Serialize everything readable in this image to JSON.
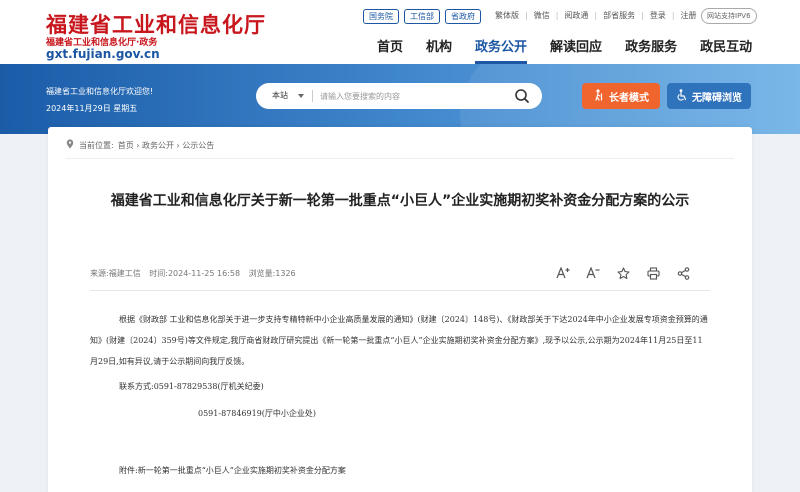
{
  "header": {
    "site_title": "福建省工业和信息化厅",
    "site_subtitle": "福建省工业和信息化厅·政务",
    "site_url": "gxt.fujian.gov.cn",
    "top_tags": [
      "国务院",
      "工信部",
      "省政府"
    ],
    "top_links": [
      "繁体版",
      "微信",
      "阅政通",
      "部省服务",
      "登录",
      "注册"
    ],
    "ipv6_badge": "网站支持IPV6",
    "nav": [
      "首页",
      "机构",
      "政务公开",
      "解读回应",
      "政务服务",
      "政民互动"
    ],
    "active_nav": "政务公开"
  },
  "banner": {
    "welcome": "福建省工业和信息化厅欢迎您!",
    "date": "2024年11月29日 星期五",
    "search_scope": "本站",
    "search_placeholder": "请输入您要搜索的内容",
    "elder_mode_label": "长者模式",
    "accessible_label": "无障碍浏览"
  },
  "breadcrumb": {
    "label": "当前位置:",
    "path": "首页 › 政务公开 › 公示公告"
  },
  "article": {
    "title": "福建省工业和信息化厅关于新一轮第一批重点“小巨人”企业实施期初奖补资金分配方案的公示",
    "source": "来源:福建工信",
    "time": "时间:2024-11-25 16:58",
    "views": "浏览量:1326",
    "body": "根据《财政部 工业和信息化部关于进一步支持专精特新中小企业高质量发展的通知》(财建〔2024〕148号)、《财政部关于下达2024年中小企业发展专项资金预算的通知》(财建〔2024〕359号)等文件规定,我厅商省财政厅研究提出《新一轮第一批重点“小巨人”企业实施期初奖补资金分配方案》,现予以公示,公示期为2024年11月25日至11月29日,如有异议,请于公示期间向我厅反馈。",
    "contact_1": "联系方式:0591-87829538(厅机关纪委)",
    "contact_2": "0591-87846919(厅中小企业处)",
    "attachment": "附件:新一轮第一批重点“小巨人”企业实施期初奖补资金分配方案"
  },
  "colors": {
    "brand_red": "#c8161d",
    "brand_blue": "#1d57a3",
    "elder_button": "#f0642d",
    "access_button": "#2f73bd"
  }
}
